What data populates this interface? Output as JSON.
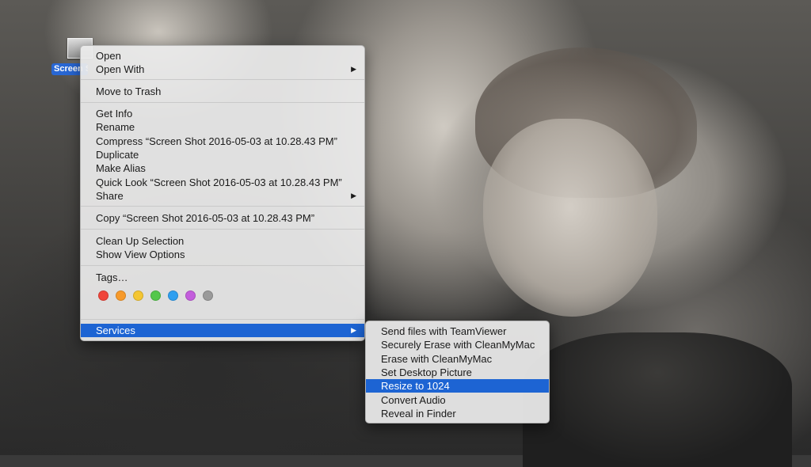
{
  "desktop_icon": {
    "label": "Screen Shot 2016..."
  },
  "menu": {
    "open": "Open",
    "open_with": "Open With",
    "move_to_trash": "Move to Trash",
    "get_info": "Get Info",
    "rename": "Rename",
    "compress": "Compress “Screen Shot 2016-05-03 at 10.28.43 PM”",
    "duplicate": "Duplicate",
    "make_alias": "Make Alias",
    "quick_look": "Quick Look “Screen Shot 2016-05-03 at 10.28.43 PM”",
    "share": "Share",
    "copy": "Copy “Screen Shot 2016-05-03 at 10.28.43 PM”",
    "clean_up": "Clean Up Selection",
    "show_view_options": "Show View Options",
    "tags": "Tags…",
    "services": "Services",
    "arrow": "▶"
  },
  "tag_colors": [
    "#f0453a",
    "#f79a2b",
    "#f4c632",
    "#54c74b",
    "#2e9ff0",
    "#c35ddc",
    "#9a9a9a"
  ],
  "services_menu": {
    "items": [
      "Send files with TeamViewer",
      "Securely Erase with CleanMyMac",
      "Erase with CleanMyMac",
      "Set Desktop Picture",
      "Resize to 1024",
      "Convert Audio",
      "Reveal in Finder"
    ],
    "highlighted": "Resize to 1024"
  },
  "colors": {
    "highlight": "#1d64d3",
    "icon_label_bg": "#2867d4"
  }
}
